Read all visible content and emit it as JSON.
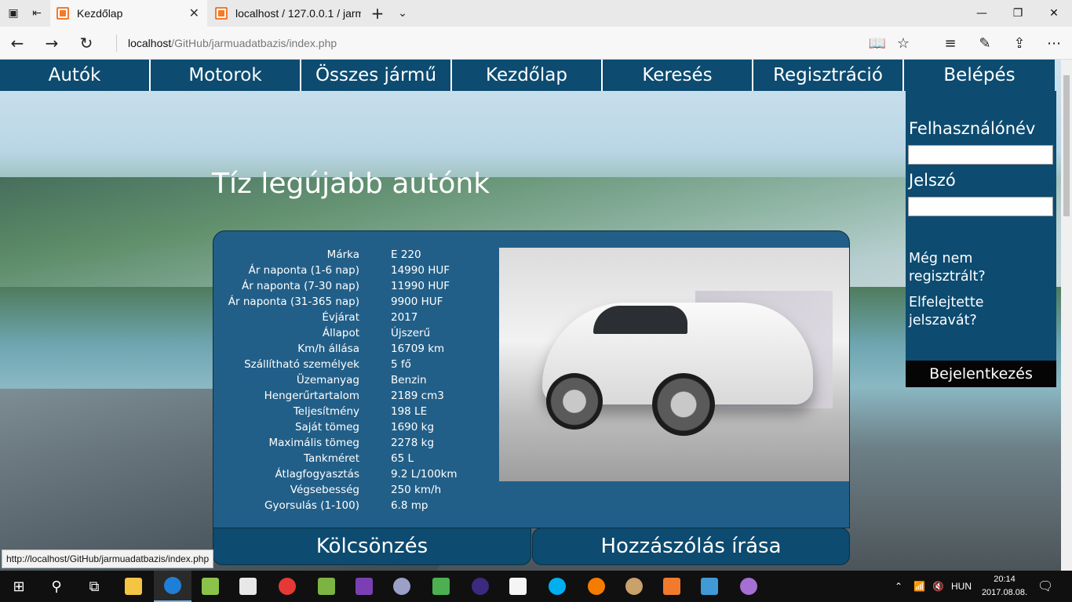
{
  "browser": {
    "tabs": [
      {
        "title": "Kezdőlap",
        "active": true
      },
      {
        "title": "localhost / 127.0.0.1 / jarmu",
        "active": false
      }
    ],
    "url_host": "localhost",
    "url_path": "/GitHub/jarmuadatbazis/index.php",
    "status_url": "http://localhost/GitHub/jarmuadatbazis/index.php"
  },
  "nav": [
    "Autók",
    "Motorok",
    "Összes jármű",
    "Kezdőlap",
    "Keresés",
    "Regisztráció",
    "Belépés"
  ],
  "headline": "Tíz legújabb autónk",
  "car": {
    "specs": [
      {
        "label": "Márka",
        "value": "E 220"
      },
      {
        "label": "Ár naponta (1-6 nap)",
        "value": "14990 HUF"
      },
      {
        "label": "Ár naponta (7-30 nap)",
        "value": "11990 HUF"
      },
      {
        "label": "Ár naponta (31-365 nap)",
        "value": "9900 HUF"
      },
      {
        "label": "Évjárat",
        "value": "2017"
      },
      {
        "label": "Állapot",
        "value": "Újszerű"
      },
      {
        "label": "Km/h állása",
        "value": "16709 km"
      },
      {
        "label": "Szállítható személyek",
        "value": "5 fő"
      },
      {
        "label": "Üzemanyag",
        "value": "Benzin"
      },
      {
        "label": "Hengerűrtartalom",
        "value": "2189 cm3"
      },
      {
        "label": "Teljesítmény",
        "value": "198 LE"
      },
      {
        "label": "Saját tömeg",
        "value": "1690 kg"
      },
      {
        "label": "Maximális tömeg",
        "value": "2278 kg"
      },
      {
        "label": "Tankméret",
        "value": "65 L"
      },
      {
        "label": "Átlagfogyasztás",
        "value": "9.2 L/100km"
      },
      {
        "label": "Végsebesség",
        "value": "250 km/h"
      },
      {
        "label": "Gyorsulás (1-100)",
        "value": "6.8 mp"
      }
    ],
    "rent_label": "Kölcsönzés",
    "comment_label": "Hozzászólás írása"
  },
  "login": {
    "username_label": "Felhasználónév",
    "password_label": "Jelszó",
    "not_registered": "Még nem regisztrált?",
    "forgot": "Elfelejtette jelszavát?",
    "submit": "Bejelentkezés"
  },
  "taskbar": {
    "language": "HUN",
    "time": "20:14",
    "date": "2017.08.08."
  },
  "colors": {
    "nav_bg": "#0d4b70",
    "card_bg": "#225f88",
    "submit_bg": "#050505"
  }
}
